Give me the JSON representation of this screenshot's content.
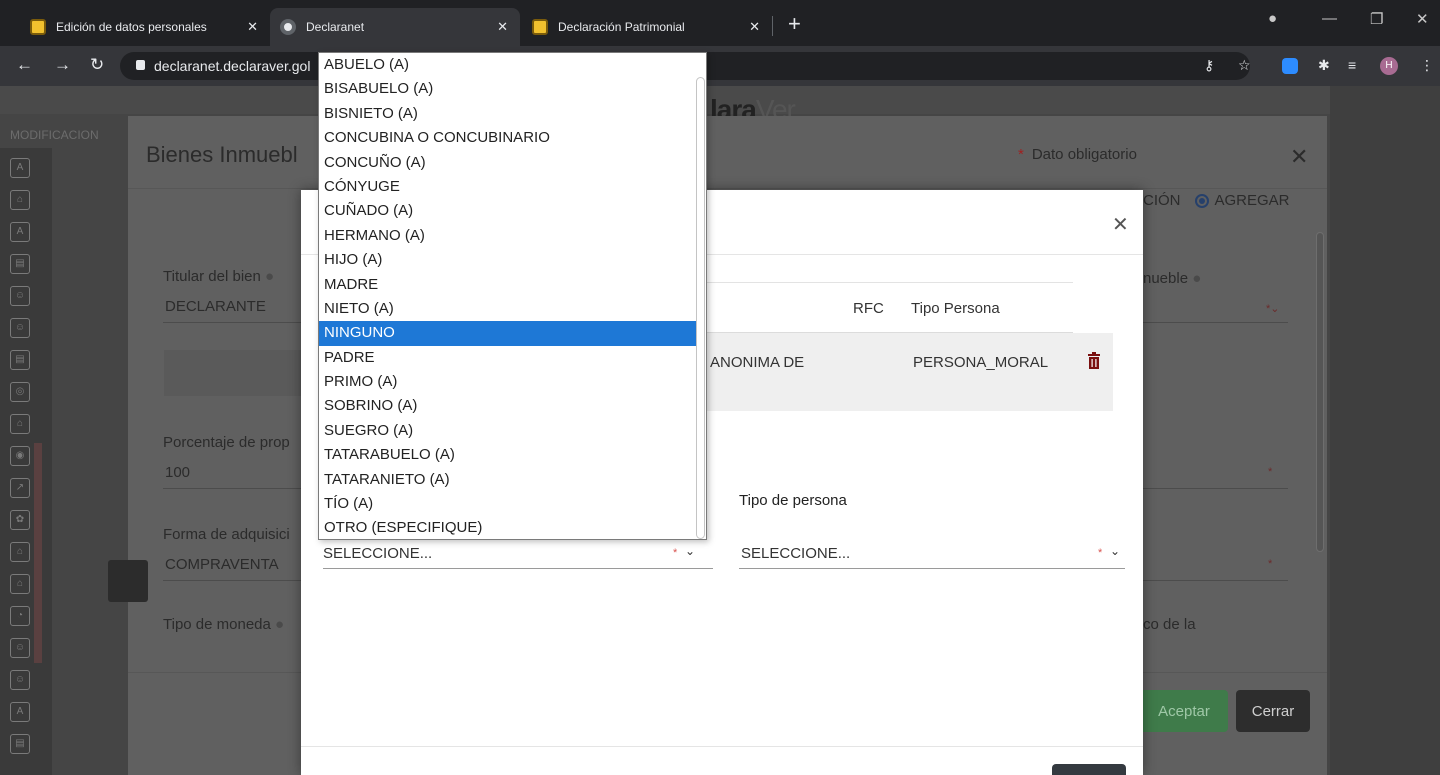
{
  "browser": {
    "tabs": [
      {
        "title": "Edición de datos personales",
        "active": false
      },
      {
        "title": "Declaranet",
        "active": true
      },
      {
        "title": "Declaración Patrimonial",
        "active": false
      }
    ],
    "url": "declaranet.declaraver.gol",
    "profile_initial": "H"
  },
  "page": {
    "logo_dark": "lara",
    "logo_light": "Ver",
    "section": "MODIFICACION"
  },
  "bg_modal": {
    "title": "Bienes Inmuebl",
    "required_note": "Dato obligatorio",
    "radio_partial": "CIÓN",
    "radio_selected": "AGREGAR",
    "fields": {
      "titular_label": "Titular del bien",
      "titular_value": "DECLARANTE",
      "tipo_inmueble_label": "nueble",
      "porcentaje_label": "Porcentaje de prop",
      "porcentaje_value": "100",
      "forma_label": "Forma de adquisici",
      "forma_value": "COMPRAVENTA",
      "moneda_label": "Tipo de moneda",
      "right_label": "co de la"
    },
    "buttons": {
      "accept": "Aceptar",
      "close": "Cerrar"
    }
  },
  "fg_modal": {
    "table_headers": {
      "rfc": "RFC",
      "tipo_persona": "Tipo Persona"
    },
    "row": {
      "name": "ANONIMA DE",
      "tipo": "PERSONA_MORAL"
    },
    "tipo_persona_label": "Tipo de persona",
    "select_left": "SELECCIONE...",
    "select_right": "SELECCIONE..."
  },
  "dropdown": {
    "selected": "NINGUNO",
    "options": [
      "ABUELO (A)",
      "BISABUELO (A)",
      "BISNIETO (A)",
      "CONCUBINA O CONCUBINARIO",
      "CONCUÑO (A)",
      "CÓNYUGE",
      "CUÑADO (A)",
      "HERMANO (A)",
      "HIJO (A)",
      "MADRE",
      "NIETO (A)",
      "NINGUNO",
      "PADRE",
      "PRIMO (A)",
      "SOBRINO (A)",
      "SUEGRO (A)",
      "TATARABUELO (A)",
      "TATARANIETO (A)",
      "TÍO (A)",
      "OTRO (ESPECIFIQUE)"
    ]
  },
  "colors": {
    "selection": "#1e78d6",
    "required": "#d9534f",
    "accept": "#3f7b4a"
  }
}
